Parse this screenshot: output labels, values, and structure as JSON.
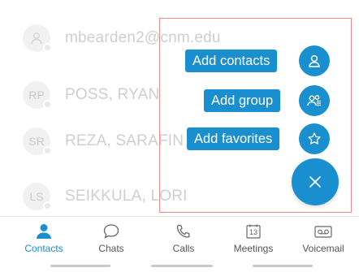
{
  "contacts": [
    {
      "initials": "",
      "name": "mbearden2@cnm.edu"
    },
    {
      "initials": "RP",
      "name": "POSS, RYAN"
    },
    {
      "initials": "SR",
      "name": "REZA, SARAFIN"
    },
    {
      "initials": "LS",
      "name": "SEIKKULA, LORI"
    }
  ],
  "fab_menu": {
    "add_contacts_label": "Add contacts",
    "add_group_label": "Add group",
    "add_favorites_label": "Add favorites"
  },
  "tabs": [
    {
      "label": "Contacts",
      "icon": "person-icon",
      "active": true
    },
    {
      "label": "Chats",
      "icon": "chat-bubble-icon",
      "active": false
    },
    {
      "label": "Calls",
      "icon": "phone-icon",
      "active": false
    },
    {
      "label": "Meetings",
      "icon": "calendar-icon",
      "active": false,
      "date": "13"
    },
    {
      "label": "Voicemail",
      "icon": "voicemail-icon",
      "active": false
    }
  ],
  "colors": {
    "accent": "#1a8fd0",
    "annotation": "#f08a8a"
  }
}
